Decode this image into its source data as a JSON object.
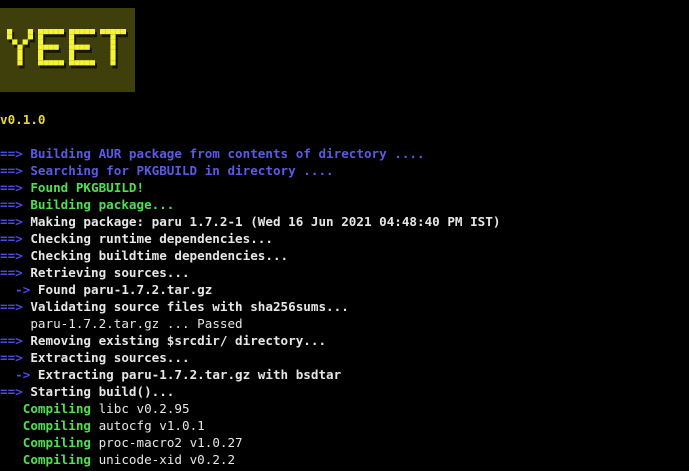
{
  "logo": {
    "text": "YEET",
    "colors": {
      "background": "#3f3f0c",
      "fill": "#f4f434",
      "shadow": "#161600"
    }
  },
  "version": "v0.1.0",
  "colors": {
    "arrow": "#4a4ae8",
    "blue": "#5a5ae6",
    "green": "#4ee04e",
    "white": "#e6e6e6",
    "yellow": "#e8d83a",
    "background": "#000000"
  },
  "lines": [
    {
      "indent": "",
      "prefix": "==>",
      "prefix_style": "arrow",
      "text": " Building AUR package from contents of directory ....",
      "style": "c-blue"
    },
    {
      "indent": "",
      "prefix": "==>",
      "prefix_style": "arrow",
      "text": " Searching for PKGBUILD in directory ....",
      "style": "c-blue"
    },
    {
      "indent": "",
      "prefix": "==>",
      "prefix_style": "arrow",
      "text": " Found PKGBUILD!",
      "style": "c-green"
    },
    {
      "indent": "",
      "prefix": "==>",
      "prefix_style": "arrow",
      "text": " Building package...",
      "style": "c-green"
    },
    {
      "indent": "",
      "prefix": "==>",
      "prefix_style": "arrow",
      "text": " Making package: paru 1.7.2-1 (Wed 16 Jun 2021 04:48:40 PM IST)",
      "style": "c-white"
    },
    {
      "indent": "",
      "prefix": "==>",
      "prefix_style": "arrow",
      "text": " Checking runtime dependencies...",
      "style": "c-white"
    },
    {
      "indent": "",
      "prefix": "==>",
      "prefix_style": "arrow",
      "text": " Checking buildtime dependencies...",
      "style": "c-white"
    },
    {
      "indent": "",
      "prefix": "==>",
      "prefix_style": "arrow",
      "text": " Retrieving sources...",
      "style": "c-white"
    },
    {
      "indent": "  ",
      "prefix": "->",
      "prefix_style": "sub-arrow",
      "text": " Found paru-1.7.2.tar.gz",
      "style": "c-white"
    },
    {
      "indent": "",
      "prefix": "==>",
      "prefix_style": "arrow",
      "text": " Validating source files with sha256sums...",
      "style": "c-white"
    },
    {
      "indent": "    ",
      "prefix": "",
      "prefix_style": "",
      "text": "paru-1.7.2.tar.gz ... Passed",
      "style": "c-plain"
    },
    {
      "indent": "",
      "prefix": "==>",
      "prefix_style": "arrow",
      "text": " Removing existing $srcdir/ directory...",
      "style": "c-white"
    },
    {
      "indent": "",
      "prefix": "==>",
      "prefix_style": "arrow",
      "text": " Extracting sources...",
      "style": "c-white"
    },
    {
      "indent": "  ",
      "prefix": "->",
      "prefix_style": "sub-arrow",
      "text": " Extracting paru-1.7.2.tar.gz with bsdtar",
      "style": "c-white"
    },
    {
      "indent": "",
      "prefix": "==>",
      "prefix_style": "arrow",
      "text": " Starting build()...",
      "style": "c-white"
    },
    {
      "indent": "   ",
      "prefix": "Compiling",
      "prefix_style": "c-compile",
      "text": " libc v0.2.95",
      "style": "c-plain"
    },
    {
      "indent": "   ",
      "prefix": "Compiling",
      "prefix_style": "c-compile",
      "text": " autocfg v1.0.1",
      "style": "c-plain"
    },
    {
      "indent": "   ",
      "prefix": "Compiling",
      "prefix_style": "c-compile",
      "text": " proc-macro2 v1.0.27",
      "style": "c-plain"
    },
    {
      "indent": "   ",
      "prefix": "Compiling",
      "prefix_style": "c-compile",
      "text": " unicode-xid v0.2.2",
      "style": "c-plain"
    }
  ]
}
